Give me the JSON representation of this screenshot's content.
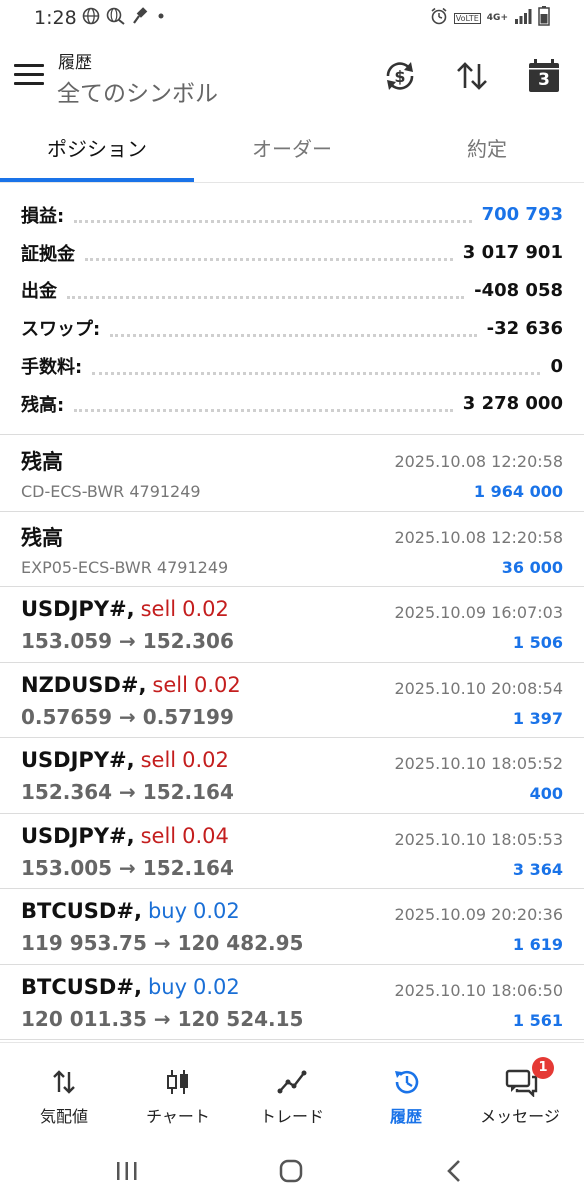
{
  "status_bar": {
    "time": "1:28",
    "left_icons": [
      "globe-icon",
      "globe-search-icon",
      "gavel-icon",
      "dot-icon"
    ],
    "right_icons": [
      "alarm-icon",
      "volte-icon",
      "4g-icon",
      "signal-icon",
      "battery-icon"
    ],
    "volte": "VoLTE",
    "net": "4G+"
  },
  "header": {
    "title": "履歴",
    "subtitle": "全てのシンボル",
    "calendar_day": "3"
  },
  "tabs": [
    {
      "label": "ポジション",
      "active": true
    },
    {
      "label": "オーダー",
      "active": false
    },
    {
      "label": "約定",
      "active": false
    }
  ],
  "summary": [
    {
      "label": "損益:",
      "value": "700 793",
      "highlight": true
    },
    {
      "label": "証拠金",
      "value": "3 017 901",
      "highlight": false
    },
    {
      "label": "出金",
      "value": "-408 058",
      "highlight": false
    },
    {
      "label": "スワップ:",
      "value": "-32 636",
      "highlight": false
    },
    {
      "label": "手数料:",
      "value": "0",
      "highlight": false
    },
    {
      "label": "残高:",
      "value": "3 278 000",
      "highlight": false
    }
  ],
  "history": [
    {
      "title": "残高",
      "side": "",
      "volume": "",
      "detail": "CD-ECS-BWR 4791249",
      "time": "2025.10.08 12:20:58",
      "amount": "1 964 000",
      "kind": "balance"
    },
    {
      "title": "残高",
      "side": "",
      "volume": "",
      "detail": "EXP05-ECS-BWR 4791249",
      "time": "2025.10.08 12:20:58",
      "amount": "36 000",
      "kind": "balance"
    },
    {
      "title": "USDJPY#,",
      "side": "sell",
      "volume": "0.02",
      "detail": "153.059 → 152.306",
      "time": "2025.10.09 16:07:03",
      "amount": "1 506",
      "kind": "trade"
    },
    {
      "title": "NZDUSD#,",
      "side": "sell",
      "volume": "0.02",
      "detail": "0.57659 → 0.57199",
      "time": "2025.10.10 20:08:54",
      "amount": "1 397",
      "kind": "trade"
    },
    {
      "title": "USDJPY#,",
      "side": "sell",
      "volume": "0.02",
      "detail": "152.364 → 152.164",
      "time": "2025.10.10 18:05:52",
      "amount": "400",
      "kind": "trade"
    },
    {
      "title": "USDJPY#,",
      "side": "sell",
      "volume": "0.04",
      "detail": "153.005 → 152.164",
      "time": "2025.10.10 18:05:53",
      "amount": "3 364",
      "kind": "trade"
    },
    {
      "title": "BTCUSD#,",
      "side": "buy",
      "volume": "0.02",
      "detail": "119 953.75 → 120 482.95",
      "time": "2025.10.09 20:20:36",
      "amount": "1 619",
      "kind": "trade"
    },
    {
      "title": "BTCUSD#,",
      "side": "buy",
      "volume": "0.02",
      "detail": "120 011.35 → 120 524.15",
      "time": "2025.10.10 18:06:50",
      "amount": "1 561",
      "kind": "trade"
    }
  ],
  "bottom_nav": [
    {
      "label": "気配値",
      "icon": "quotes-arrows-icon",
      "active": false
    },
    {
      "label": "チャート",
      "icon": "candlestick-icon",
      "active": false
    },
    {
      "label": "トレード",
      "icon": "trade-line-icon",
      "active": false
    },
    {
      "label": "履歴",
      "icon": "history-clock-icon",
      "active": true
    },
    {
      "label": "メッセージ",
      "icon": "chat-bubbles-icon",
      "active": false,
      "badge": "1"
    }
  ],
  "colors": {
    "accent": "#1a73e8",
    "sell": "#c41e1e",
    "buy": "#1a6fd6",
    "badge": "#e53935"
  }
}
